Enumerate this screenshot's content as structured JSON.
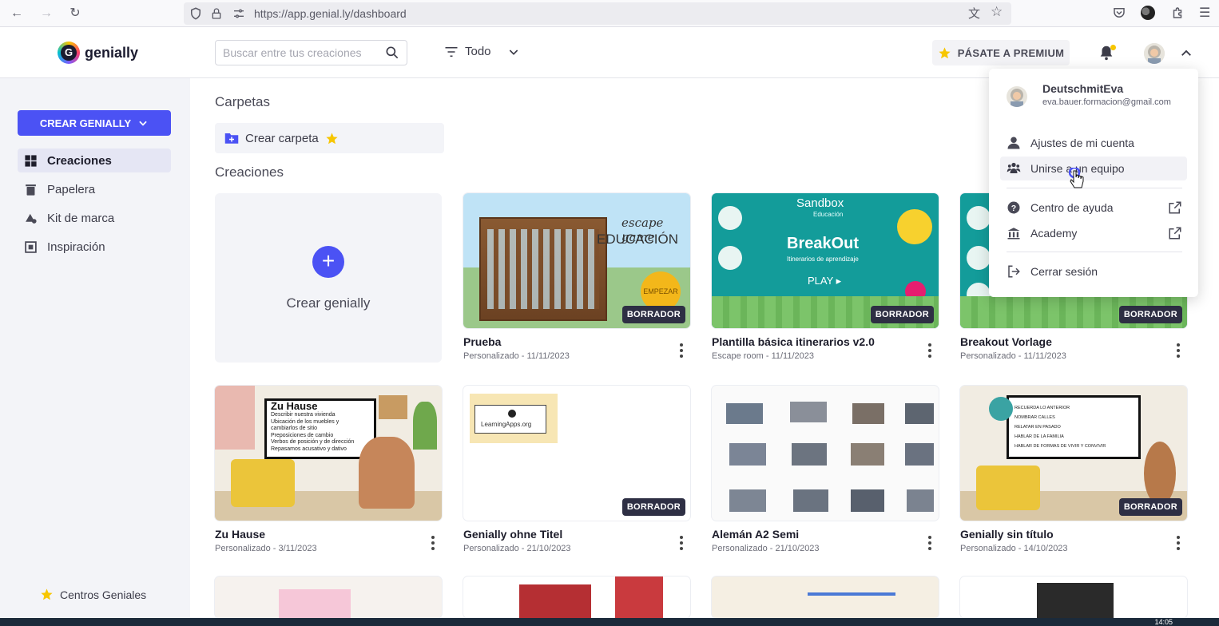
{
  "browser": {
    "url": "https://app.genial.ly/dashboard"
  },
  "brand": {
    "name": "genially",
    "logo_letter": "G",
    "accent": "#4b52f4"
  },
  "header": {
    "search_placeholder": "Buscar entre tus creaciones",
    "filter_label": "Todo",
    "premium_label": "PÁSATE A PREMIUM"
  },
  "sidebar": {
    "create_label": "CREAR GENIALLY",
    "items": [
      {
        "label": "Creaciones",
        "icon": "grid-icon",
        "active": true
      },
      {
        "label": "Papelera",
        "icon": "trash-icon",
        "active": false
      },
      {
        "label": "Kit de marca",
        "icon": "brand-kit-icon",
        "active": false
      },
      {
        "label": "Inspiración",
        "icon": "inspiration-icon",
        "active": false
      }
    ],
    "footer_label": "Centros Geniales"
  },
  "main": {
    "folders_title": "Carpetas",
    "create_folder_label": "Crear carpeta",
    "creations_title": "Creaciones",
    "create_card_label": "Crear genially",
    "badge_label": "BORRADOR",
    "cards": [
      {
        "title": "Prueba",
        "sub": "Personalizado - 11/11/2023",
        "draft": true
      },
      {
        "title": "Plantilla básica itinerarios v2.0",
        "sub": "Escape room - 11/11/2023",
        "draft": true
      },
      {
        "title": "Breakout Vorlage",
        "sub": "Personalizado - 11/11/2023",
        "draft": true
      },
      {
        "title": "Zu Hause",
        "sub": "Personalizado - 3/11/2023",
        "draft": false
      },
      {
        "title": "Genially ohne Titel",
        "sub": "Personalizado - 21/10/2023",
        "draft": true
      },
      {
        "title": "Alemán A2 Semi",
        "sub": "Personalizado - 21/10/2023",
        "draft": false
      },
      {
        "title": "Genially sin título",
        "sub": "Personalizado - 14/10/2023",
        "draft": true
      }
    ],
    "thumb_texts": {
      "escape_game": "escape game",
      "educacion": "EDUCACIÓN",
      "empezar": "EMPEZAR",
      "sandbox": "Sandbox",
      "educacion_small": "Educación",
      "breakout": "BreakOut",
      "itinerarios": "Itinerarios de aprendizaje",
      "play": "PLAY ▸",
      "zu_hause": "Zu Hause",
      "zu_hause_lines": [
        "Describir nuestra vivienda",
        "Ubicación de los muebles y",
        "cambiarlos de sitio",
        "Preposiciones de cambio",
        "Verbos de posición y de dirección",
        "Repasamos acusativo y dativo"
      ],
      "learningapps": "LearningApps.org",
      "sin_titulo_lines": [
        "RECUERDA LO ANTERIOR",
        "NOMBRAR CALLES",
        "RELATAR EN PASADO",
        "HABLAR DE LA FAMILIA",
        "HABLAR DE FORMAS DE VIVIR Y CONVIVIR"
      ]
    }
  },
  "user_menu": {
    "name": "DeutschmitEva",
    "email": "eva.bauer.formacion@gmail.com",
    "items": [
      {
        "label": "Ajustes de mi cuenta",
        "icon": "user-icon"
      },
      {
        "label": "Unirse a un equipo",
        "icon": "team-icon"
      },
      {
        "label": "Centro de ayuda",
        "icon": "help-icon"
      },
      {
        "label": "Academy",
        "icon": "academy-icon"
      },
      {
        "label": "Cerrar sesión",
        "icon": "logout-icon"
      }
    ]
  },
  "taskbar": {
    "time": "14:05"
  }
}
